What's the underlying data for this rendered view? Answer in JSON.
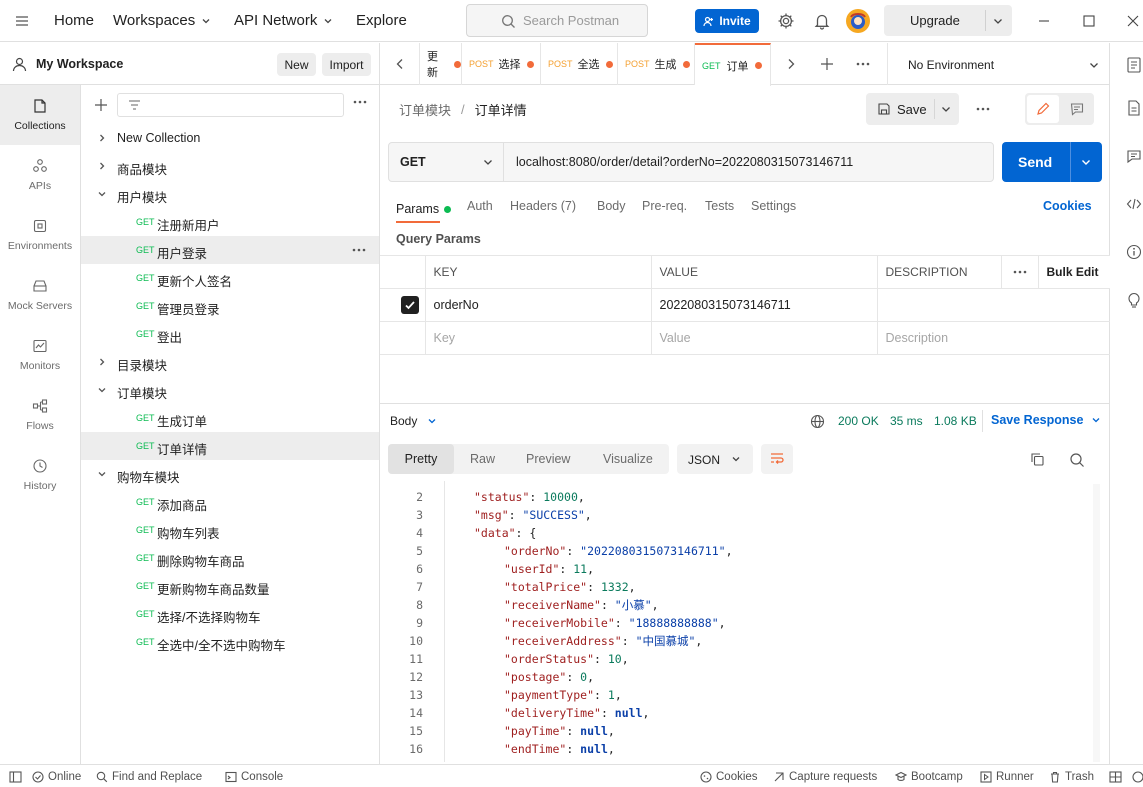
{
  "topbar": {
    "nav": [
      "Home",
      "Workspaces",
      "API Network",
      "Explore"
    ],
    "search_placeholder": "Search Postman",
    "invite_label": "Invite",
    "upgrade_label": "Upgrade"
  },
  "workspace": {
    "name": "My Workspace",
    "new_label": "New",
    "import_label": "Import"
  },
  "rail": [
    "Collections",
    "APIs",
    "Environments",
    "Mock Servers",
    "Monitors",
    "Flows",
    "History"
  ],
  "tree": [
    {
      "label": "New Collection",
      "type": "folder",
      "open": false
    },
    {
      "label": "商品模块",
      "type": "folder",
      "open": false
    },
    {
      "label": "用户模块",
      "type": "folder",
      "open": true
    },
    {
      "label": "注册新用户",
      "type": "req",
      "method": "GET"
    },
    {
      "label": "用户登录",
      "type": "req",
      "method": "GET"
    },
    {
      "label": "更新个人签名",
      "type": "req",
      "method": "GET"
    },
    {
      "label": "管理员登录",
      "type": "req",
      "method": "GET"
    },
    {
      "label": "登出",
      "type": "req",
      "method": "GET"
    },
    {
      "label": "目录模块",
      "type": "folder",
      "open": false
    },
    {
      "label": "订单模块",
      "type": "folder",
      "open": true
    },
    {
      "label": "生成订单",
      "type": "req",
      "method": "GET"
    },
    {
      "label": "订单详情",
      "type": "req",
      "method": "GET"
    },
    {
      "label": "购物车模块",
      "type": "folder",
      "open": true
    },
    {
      "label": "添加商品",
      "type": "req",
      "method": "GET"
    },
    {
      "label": "购物车列表",
      "type": "req",
      "method": "GET"
    },
    {
      "label": "删除购物车商品",
      "type": "req",
      "method": "GET"
    },
    {
      "label": "更新购物车商品数量",
      "type": "req",
      "method": "GET"
    },
    {
      "label": "选择/不选择购物车",
      "type": "req",
      "method": "GET"
    },
    {
      "label": "全选中/全不选中购物车",
      "type": "req",
      "method": "GET"
    }
  ],
  "tabs": [
    {
      "method": "",
      "label": "更新"
    },
    {
      "method": "POST",
      "label": "选择"
    },
    {
      "method": "POST",
      "label": "全选"
    },
    {
      "method": "POST",
      "label": "生成"
    },
    {
      "method": "GET",
      "label": "订单"
    }
  ],
  "environment": "No Environment",
  "request": {
    "breadcrumb_parent": "订单模块",
    "breadcrumb_sep": "/",
    "breadcrumb_current": "订单详情",
    "save_label": "Save",
    "method": "GET",
    "url": "localhost:8080/order/detail?orderNo=2022080315073146711",
    "send_label": "Send",
    "tabs": [
      "Params",
      "Auth",
      "Headers (7)",
      "Body",
      "Pre-req.",
      "Tests",
      "Settings"
    ],
    "cookies_label": "Cookies",
    "query_params_title": "Query Params",
    "columns": [
      "KEY",
      "VALUE",
      "DESCRIPTION"
    ],
    "bulk_edit_label": "Bulk Edit",
    "rows": [
      {
        "key": "orderNo",
        "value": "2022080315073146711",
        "checked": true
      }
    ],
    "placeholders": {
      "key": "Key",
      "value": "Value",
      "description": "Description"
    }
  },
  "response": {
    "label": "Body",
    "status": "200 OK",
    "time": "35 ms",
    "size": "1.08 KB",
    "save_label": "Save Response",
    "views": [
      "Pretty",
      "Raw",
      "Preview",
      "Visualize"
    ],
    "format": "JSON",
    "lines": [
      {
        "n": "2",
        "indent": 1,
        "key": "\"status\"",
        "value": "10000",
        "vtype": "num",
        "tail": ","
      },
      {
        "n": "3",
        "indent": 1,
        "key": "\"msg\"",
        "value": "\"SUCCESS\"",
        "vtype": "str",
        "tail": ","
      },
      {
        "n": "4",
        "indent": 1,
        "key": "\"data\"",
        "value": "{",
        "vtype": "punct",
        "tail": ""
      },
      {
        "n": "5",
        "indent": 2,
        "key": "\"orderNo\"",
        "value": "\"2022080315073146711\"",
        "vtype": "str",
        "tail": ","
      },
      {
        "n": "6",
        "indent": 2,
        "key": "\"userId\"",
        "value": "11",
        "vtype": "num",
        "tail": ","
      },
      {
        "n": "7",
        "indent": 2,
        "key": "\"totalPrice\"",
        "value": "1332",
        "vtype": "num",
        "tail": ","
      },
      {
        "n": "8",
        "indent": 2,
        "key": "\"receiverName\"",
        "value": "\"小慕\"",
        "vtype": "str",
        "tail": ","
      },
      {
        "n": "9",
        "indent": 2,
        "key": "\"receiverMobile\"",
        "value": "\"18888888888\"",
        "vtype": "str",
        "tail": ","
      },
      {
        "n": "10",
        "indent": 2,
        "key": "\"receiverAddress\"",
        "value": "\"中国慕城\"",
        "vtype": "str",
        "tail": ","
      },
      {
        "n": "11",
        "indent": 2,
        "key": "\"orderStatus\"",
        "value": "10",
        "vtype": "num",
        "tail": ","
      },
      {
        "n": "12",
        "indent": 2,
        "key": "\"postage\"",
        "value": "0",
        "vtype": "num",
        "tail": ","
      },
      {
        "n": "13",
        "indent": 2,
        "key": "\"paymentType\"",
        "value": "1",
        "vtype": "num",
        "tail": ","
      },
      {
        "n": "14",
        "indent": 2,
        "key": "\"deliveryTime\"",
        "value": "null",
        "vtype": "kw",
        "tail": ","
      },
      {
        "n": "15",
        "indent": 2,
        "key": "\"payTime\"",
        "value": "null",
        "vtype": "kw",
        "tail": ","
      },
      {
        "n": "16",
        "indent": 2,
        "key": "\"endTime\"",
        "value": "null",
        "vtype": "kw",
        "tail": ","
      }
    ]
  },
  "statusbar": {
    "online": "Online",
    "find_replace": "Find and Replace",
    "console": "Console",
    "cookies": "Cookies",
    "capture": "Capture requests",
    "bootcamp": "Bootcamp",
    "runner": "Runner",
    "trash": "Trash"
  },
  "colors": {
    "accent": "#0265d2",
    "get": "#0cbb52",
    "post": "#f4a031",
    "status_ok": "#0a7a5c"
  }
}
